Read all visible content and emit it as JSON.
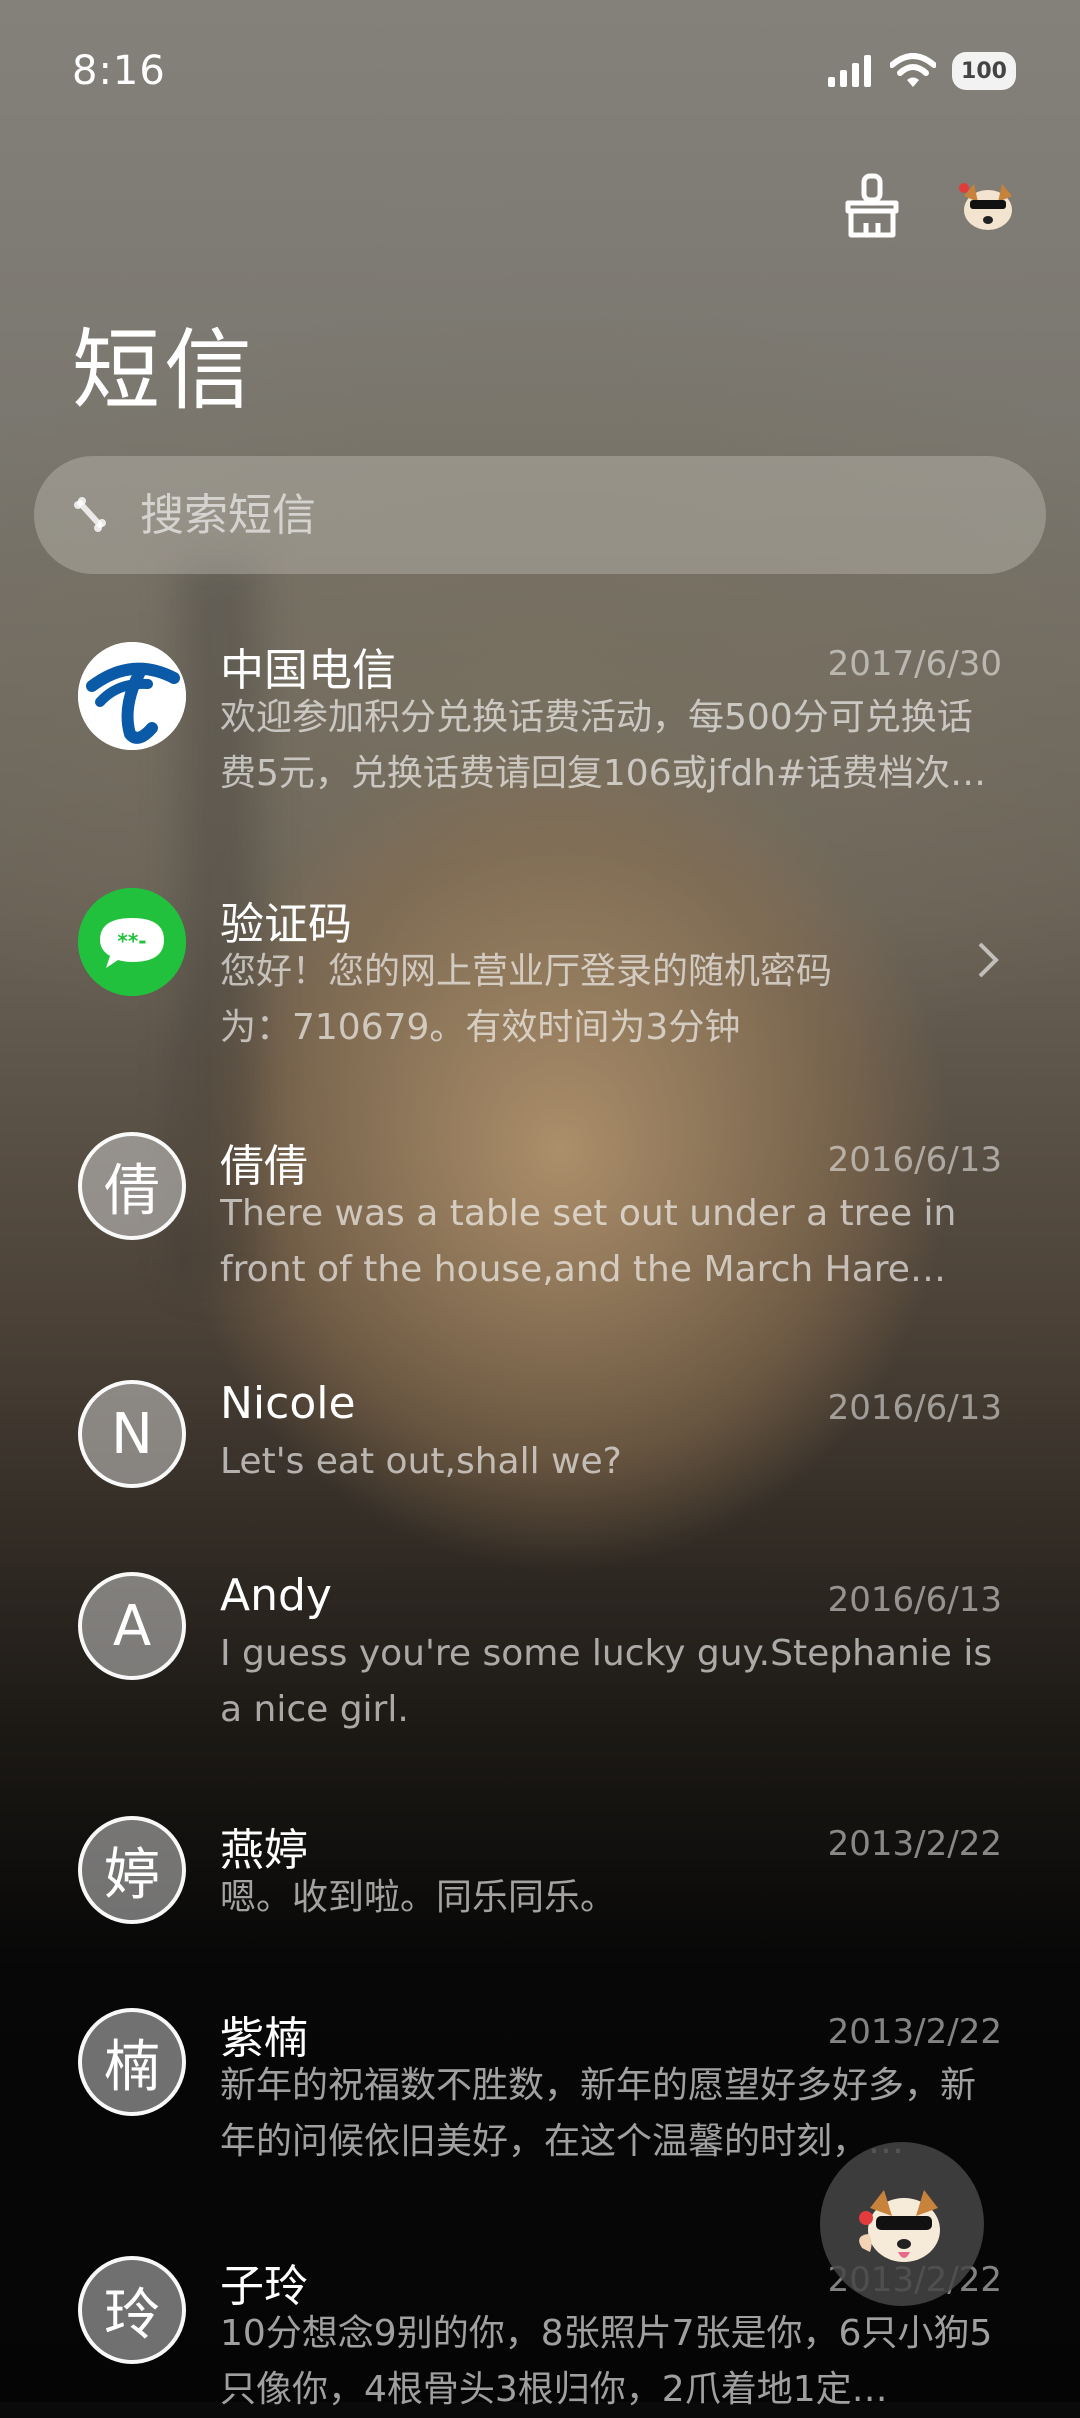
{
  "status_bar": {
    "time": "8:16",
    "battery": "100"
  },
  "header": {
    "title": "短信",
    "search_placeholder": "搜索短信"
  },
  "icons": {
    "signal": "signal-icon",
    "wifi": "wifi-icon",
    "battery": "battery-icon",
    "clean": "broom-icon",
    "profile": "dog-avatar-icon",
    "search": "bone-icon",
    "chevron": "chevron-right-icon"
  },
  "conversations": [
    {
      "name": "中国电信",
      "date": "2017/6/30",
      "preview": "欢迎参加积分兑换话费活动，每500分可兑换话费5元，兑换话费请回复106或jfdh#话费档次#…",
      "avatar_text": ""
    },
    {
      "name": "验证码",
      "date": "",
      "preview": "您好！您的网上营业厅登录的随机密码为：710679。有效时间为3分钟",
      "avatar_text": "**-"
    },
    {
      "name": "倩倩",
      "date": "2016/6/13",
      "preview": "There was a table set out under a tree in front of the house,and the March Hare and…",
      "avatar_text": "倩"
    },
    {
      "name": "Nicole",
      "date": "2016/6/13",
      "preview": "Let's eat out,shall we?",
      "avatar_text": "N"
    },
    {
      "name": "Andy",
      "date": "2016/6/13",
      "preview": "I guess you're some lucky guy.Stephanie is a nice girl.",
      "avatar_text": "A"
    },
    {
      "name": "燕婷",
      "date": "2013/2/22",
      "preview": "嗯。收到啦。同乐同乐。",
      "avatar_text": "婷"
    },
    {
      "name": "紫楠",
      "date": "2013/2/22",
      "preview": "新年的祝福数不胜数，新年的愿望好多好多，新年的问候依旧美好，在这个温馨的时刻，…",
      "avatar_text": "楠"
    },
    {
      "name": "子玲",
      "date": "2013/2/22",
      "preview": "10分想念9别的你，8张照片7张是你，6只小狗5只像你，4根骨头3根归你，2爪着地1定…",
      "avatar_text": "玲"
    }
  ]
}
